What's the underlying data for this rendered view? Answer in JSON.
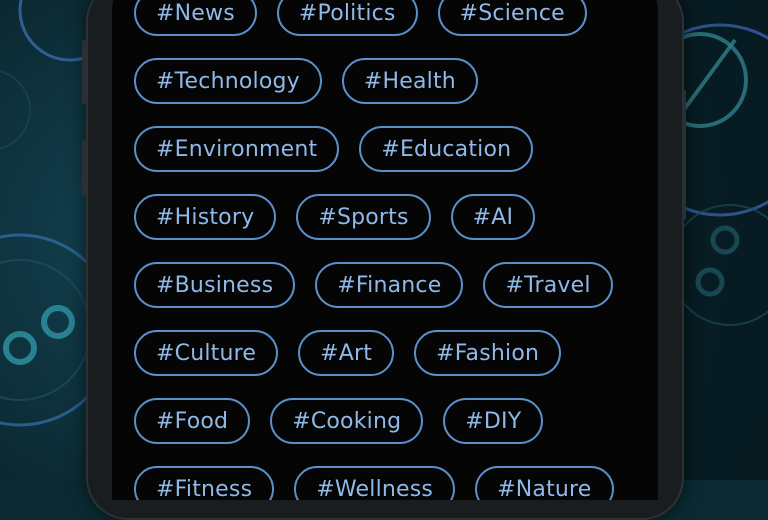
{
  "tag_rows": [
    [
      "#News",
      "#Politics",
      "#Science"
    ],
    [
      "#Technology",
      "#Health"
    ],
    [
      "#Environment",
      "#Education"
    ],
    [
      "#History",
      "#Sports",
      "#AI"
    ],
    [
      "#Business",
      "#Finance",
      "#Travel"
    ],
    [
      "#Culture",
      "#Art",
      "#Fashion"
    ],
    [
      "#Food",
      "#Cooking",
      "#DIY"
    ],
    [
      "#Fitness",
      "#Wellness",
      "#Nature"
    ]
  ],
  "colors": {
    "tag_border": "#5b8fc7",
    "tag_text": "#8fb9e8",
    "screen_bg": "#050505",
    "wallpaper": "#0b2a33"
  }
}
